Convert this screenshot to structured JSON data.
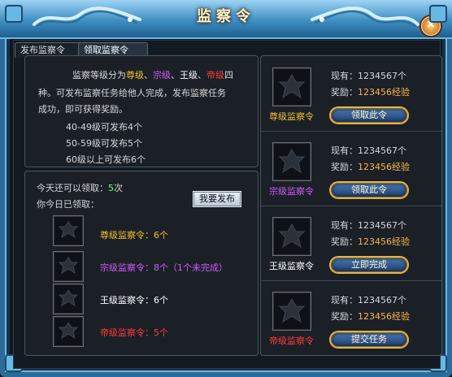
{
  "title": "监察令",
  "tabs": [
    {
      "label": "发布监察令"
    },
    {
      "label": "领取监察令"
    }
  ],
  "info": {
    "line1_prefix": "监察等级分为",
    "levels": [
      {
        "label": "尊级",
        "sep": "、"
      },
      {
        "label": "宗级",
        "sep": "、"
      },
      {
        "label": "王级",
        "sep": "、"
      },
      {
        "label": "帝级",
        "sep": "四"
      }
    ],
    "line2": "种。可发布监察任务给他人完成，发布监察任务",
    "line3": "成功，即可获得奖励。",
    "rules": [
      "40-49级可发布4个",
      "50-59级可发布5个",
      "60级以上可发布6个"
    ]
  },
  "claim": {
    "today_prefix": "今天还可以领取：",
    "today_count": "5",
    "today_suffix": "次",
    "received_label": "你今日已领取：",
    "publish_button": "我要发布",
    "rows": [
      {
        "text": "尊级监察令：6个",
        "color": "#f3c12b"
      },
      {
        "text": "宗级监察令：8个（1个未完成）",
        "color": "#d25bff"
      },
      {
        "text": "王级监察令：6个",
        "color": "#ffffff"
      },
      {
        "text": "帝级监察令：5个",
        "color": "#ff3b3b"
      }
    ]
  },
  "right_items": [
    {
      "name": "尊级监察令",
      "name_color": "#f3c12b",
      "owned_label": "现有：",
      "owned_value": "1234567个",
      "reward_label": "奖励：",
      "reward_value": "123456经验",
      "button": "领取此令"
    },
    {
      "name": "宗级监察令",
      "name_color": "#d25bff",
      "owned_label": "现有：",
      "owned_value": "1234567个",
      "reward_label": "奖励：",
      "reward_value": "123456经验",
      "button": "领取此令"
    },
    {
      "name": "王级监察令",
      "name_color": "#ffffff",
      "owned_label": "现有：",
      "owned_value": "1234567个",
      "reward_label": "奖励：",
      "reward_value": "123456经验",
      "button": "立即完成"
    },
    {
      "name": "帝级监察令",
      "name_color": "#ff3b3b",
      "owned_label": "现有：",
      "owned_value": "1234567个",
      "reward_label": "奖励：",
      "reward_value": "123456经验",
      "button": "提交任务"
    }
  ],
  "colors": {
    "frame_blue": "#2a6b9a",
    "gold": "#f3c12b",
    "purple": "#d25bff",
    "red": "#ff3b3b",
    "orange": "#ffb54a",
    "green": "#7dff6a"
  },
  "icons": {
    "close": "close-icon",
    "dragon": "dragon-decoration-icon",
    "token": "token-icon"
  }
}
